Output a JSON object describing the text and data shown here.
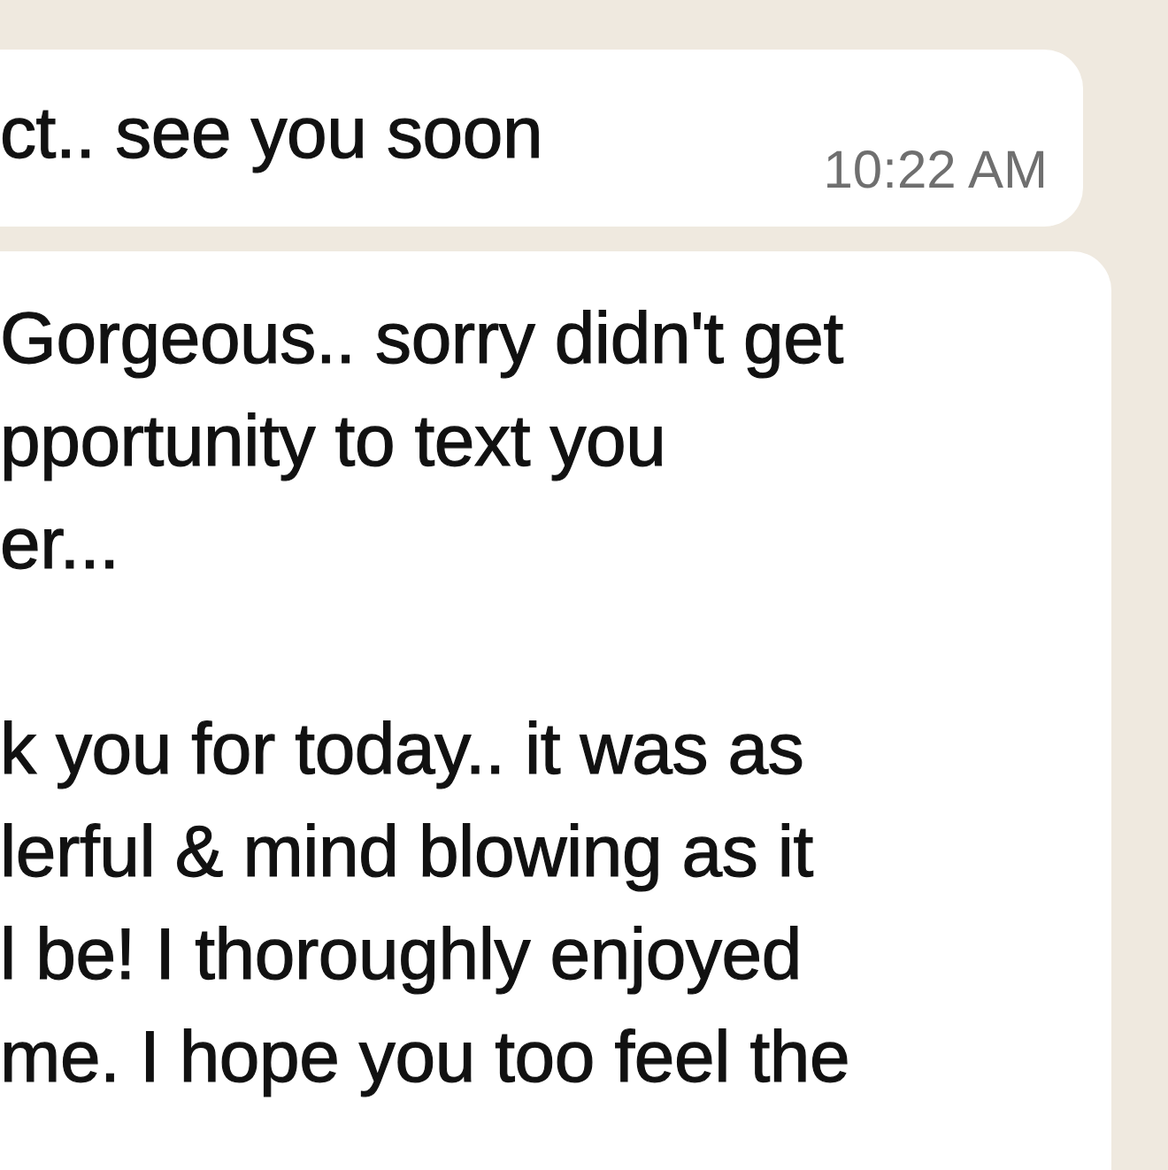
{
  "messages": [
    {
      "kind": "short",
      "lines": [
        "ct.. see you soon"
      ],
      "time": "10:22 AM"
    },
    {
      "kind": "long",
      "paragraphs": [
        [
          "Gorgeous.. sorry didn't get",
          "pportunity to text you",
          "er..."
        ],
        [
          "k you for today.. it was as",
          "lerful & mind blowing as it",
          "l be! I thoroughly enjoyed",
          "me. I hope you too feel the"
        ]
      ]
    }
  ]
}
